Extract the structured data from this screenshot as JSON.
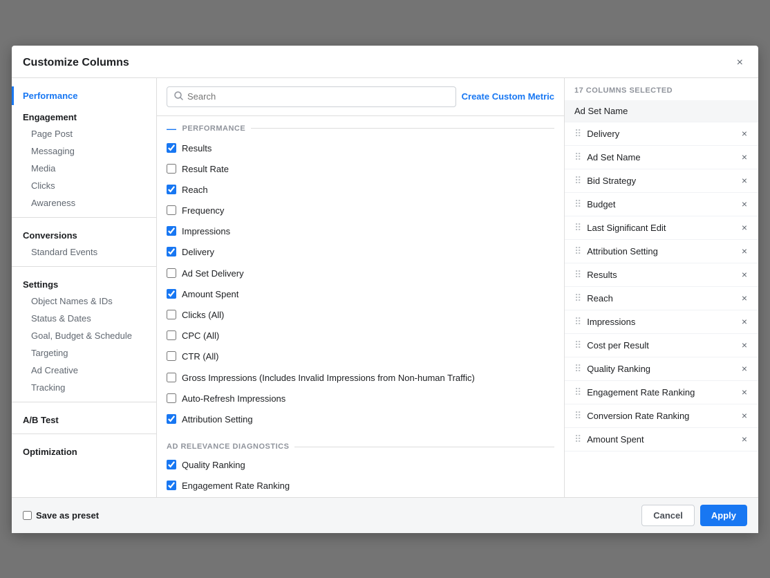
{
  "modal": {
    "title": "Customize Columns",
    "close_label": "×"
  },
  "sidebar": {
    "active_item": "Performance",
    "items": [
      {
        "type": "top",
        "label": "Performance"
      },
      {
        "type": "category",
        "label": "Engagement"
      },
      {
        "type": "sub",
        "label": "Page Post"
      },
      {
        "type": "sub",
        "label": "Messaging"
      },
      {
        "type": "sub",
        "label": "Media"
      },
      {
        "type": "sub",
        "label": "Clicks"
      },
      {
        "type": "sub",
        "label": "Awareness"
      },
      {
        "type": "category",
        "label": "Conversions"
      },
      {
        "type": "sub",
        "label": "Standard Events"
      },
      {
        "type": "category",
        "label": "Settings"
      },
      {
        "type": "sub",
        "label": "Object Names & IDs"
      },
      {
        "type": "sub",
        "label": "Status & Dates"
      },
      {
        "type": "sub",
        "label": "Goal, Budget & Schedule"
      },
      {
        "type": "sub",
        "label": "Targeting"
      },
      {
        "type": "sub",
        "label": "Ad Creative"
      },
      {
        "type": "sub",
        "label": "Tracking"
      },
      {
        "type": "category",
        "label": "A/B Test"
      },
      {
        "type": "category",
        "label": "Optimization"
      }
    ]
  },
  "search": {
    "placeholder": "Search",
    "create_custom_metric_label": "Create Custom Metric"
  },
  "performance_section": {
    "header": "PERFORMANCE",
    "items": [
      {
        "label": "Results",
        "checked": true
      },
      {
        "label": "Result Rate",
        "checked": false
      },
      {
        "label": "Reach",
        "checked": true
      },
      {
        "label": "Frequency",
        "checked": false
      },
      {
        "label": "Impressions",
        "checked": true
      },
      {
        "label": "Delivery",
        "checked": true
      },
      {
        "label": "Ad Set Delivery",
        "checked": false
      },
      {
        "label": "Amount Spent",
        "checked": true
      },
      {
        "label": "Clicks (All)",
        "checked": false
      },
      {
        "label": "CPC (All)",
        "checked": false
      },
      {
        "label": "CTR (All)",
        "checked": false
      },
      {
        "label": "Gross Impressions (Includes Invalid Impressions from Non-human Traffic)",
        "checked": false
      },
      {
        "label": "Auto-Refresh Impressions",
        "checked": false
      },
      {
        "label": "Attribution Setting",
        "checked": true
      }
    ]
  },
  "ad_relevance_section": {
    "header": "AD RELEVANCE DIAGNOSTICS",
    "items": [
      {
        "label": "Quality Ranking",
        "checked": true
      },
      {
        "label": "Engagement Rate Ranking",
        "checked": true
      }
    ]
  },
  "selected_columns": {
    "count_label": "17 COLUMNS SELECTED",
    "items": [
      {
        "label": "Ad Set Name",
        "fixed": true,
        "removable": false
      },
      {
        "label": "Delivery",
        "fixed": false,
        "removable": true
      },
      {
        "label": "Ad Set Name",
        "fixed": false,
        "removable": true
      },
      {
        "label": "Bid Strategy",
        "fixed": false,
        "removable": true
      },
      {
        "label": "Budget",
        "fixed": false,
        "removable": true
      },
      {
        "label": "Last Significant Edit",
        "fixed": false,
        "removable": true
      },
      {
        "label": "Attribution Setting",
        "fixed": false,
        "removable": true
      },
      {
        "label": "Results",
        "fixed": false,
        "removable": true
      },
      {
        "label": "Reach",
        "fixed": false,
        "removable": true
      },
      {
        "label": "Impressions",
        "fixed": false,
        "removable": true
      },
      {
        "label": "Cost per Result",
        "fixed": false,
        "removable": true
      },
      {
        "label": "Quality Ranking",
        "fixed": false,
        "removable": true
      },
      {
        "label": "Engagement Rate Ranking",
        "fixed": false,
        "removable": true
      },
      {
        "label": "Conversion Rate Ranking",
        "fixed": false,
        "removable": true
      },
      {
        "label": "Amount Spent",
        "fixed": false,
        "removable": true
      }
    ]
  },
  "footer": {
    "save_preset_label": "Save as preset",
    "cancel_label": "Cancel",
    "apply_label": "Apply"
  }
}
